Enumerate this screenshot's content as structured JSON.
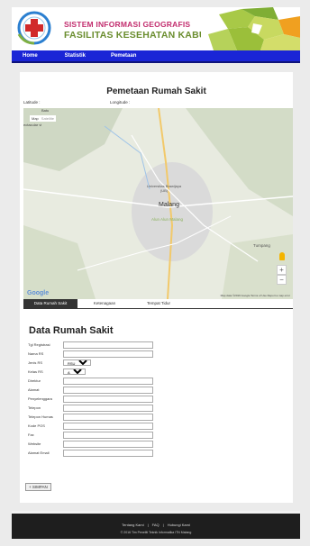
{
  "header": {
    "title_line1": "SISTEM INFORMASI GEOGRAFIS",
    "title_line2": "FASILITAS KESEHATAN KABUPATEN MALANG",
    "colors": {
      "title1": "#c22d6e",
      "title2": "#6a8d2e",
      "nav": "#1a25d6"
    }
  },
  "nav": {
    "items": [
      {
        "label": "Home"
      },
      {
        "label": "Statistik"
      },
      {
        "label": "Pemetaan"
      }
    ]
  },
  "page": {
    "title": "Pemetaan Rumah Sakit",
    "latitude_label": "Latitude :",
    "longitude_label": "Longitude :"
  },
  "map": {
    "type_map": "Map",
    "type_satellite": "Satellite",
    "side_label_1": "Batu",
    "side_label_2": "ectacular vi",
    "places": [
      "Universitas Brawijaya (UB)",
      "Malang",
      "Alun Alun Malang",
      "Tumpang"
    ],
    "google": "Google",
    "attribution": "Map data ©2016 Google   Terms of Use   Report a map error",
    "zoom_in": "+",
    "zoom_out": "−"
  },
  "tabs": [
    {
      "label": "Data Rumah Sakit"
    },
    {
      "label": "Ketenagaan"
    },
    {
      "label": "Tempat Tidur"
    }
  ],
  "form": {
    "title": "Data Rumah Sakit",
    "fields": {
      "tgl_registrasi": "Tgl Registrasi",
      "nama_rs": "Nama RS",
      "jenis_rs": "Jenis RS",
      "jenis_rs_value": "RSU",
      "kelas_rs": "Kelas RS",
      "kelas_rs_value": "A",
      "direktur": "Direktur",
      "alamat": "Alamat",
      "penyelenggara": "Penyelenggara",
      "telepon": "Telepon",
      "telepon_humas": "Telepon Humas",
      "kode_pos": "Kode POS",
      "fax": "Fax",
      "website": "Website",
      "alamat_email": "Alamat Email"
    },
    "save_label": "+ SIMPAN"
  },
  "footer": {
    "links": [
      "Tentang Kami",
      "FAQ",
      "Hubungi Kami"
    ],
    "copyright": "© 2016 Tim Peneliti Teknik Informatika ITN Malang"
  }
}
